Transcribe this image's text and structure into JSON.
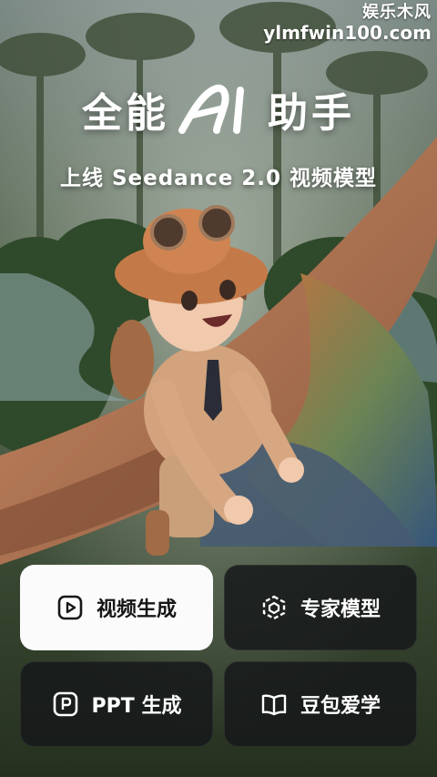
{
  "watermark": {
    "line1": "娱乐木风",
    "line2": "ylmfwin100.com"
  },
  "header": {
    "title_left": "全能",
    "title_logo_text": "AI",
    "title_right": "助手",
    "subtitle": "上线 Seedance 2.0 视频模型"
  },
  "actions": [
    {
      "label": "视频生成",
      "icon": "play-icon",
      "selected": true
    },
    {
      "label": "专家模型",
      "icon": "cube-icon",
      "selected": false
    },
    {
      "label": "PPT 生成",
      "icon": "ppt-icon",
      "selected": false
    },
    {
      "label": "豆包爱学",
      "icon": "book-icon",
      "selected": false
    }
  ],
  "colors": {
    "button_dark": "#16181a",
    "button_light": "#fbfbfb",
    "text": "#ffffff"
  }
}
